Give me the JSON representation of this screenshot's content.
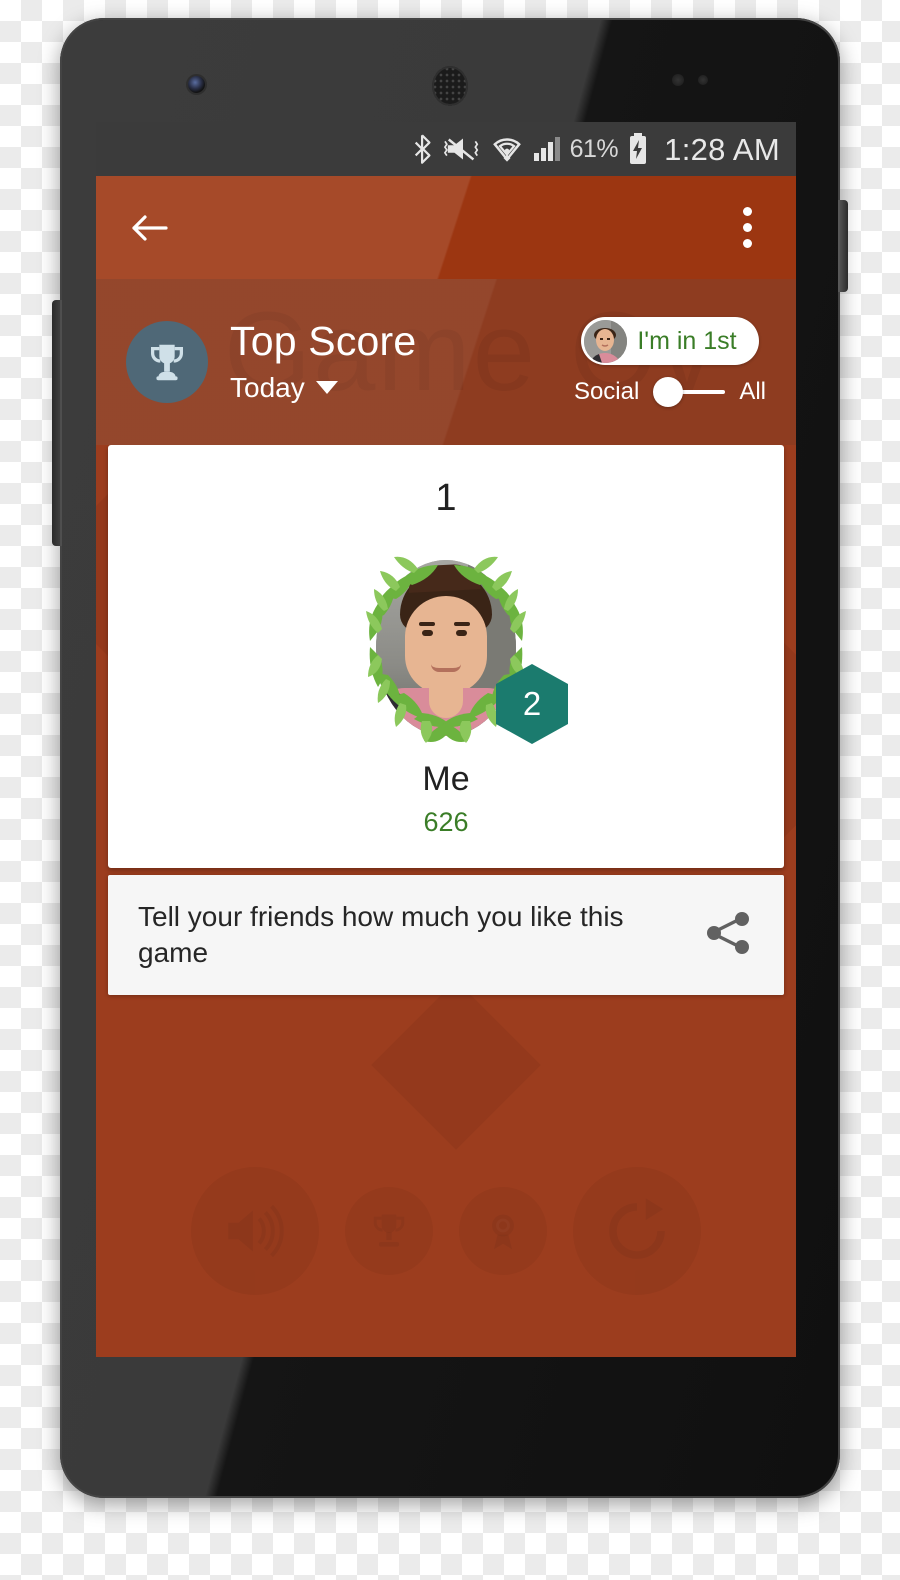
{
  "statusbar": {
    "icons": [
      "bluetooth-icon",
      "volume-mute-vibrate-icon",
      "wifi-icon",
      "cellular-signal-icon",
      "battery-charging-icon"
    ],
    "battery_percent": "61%",
    "time": "1:28 AM"
  },
  "toolbar": {
    "back_label": "back-arrow",
    "overflow_label": "more-options"
  },
  "header": {
    "watermark": "Game Ov",
    "title": "Top Score",
    "period": "Today",
    "rank_pill": "I'm in 1st",
    "toggle": {
      "left_label": "Social",
      "right_label": "All",
      "selected": "Social"
    }
  },
  "leaderboard": {
    "rank": "1",
    "name": "Me",
    "score": "626",
    "badge_level": "2"
  },
  "share": {
    "text": "Tell your friends how much you like this game",
    "icon": "share-icon"
  },
  "background_buttons": [
    {
      "name": "sound-button",
      "icon": "volume-up-icon"
    },
    {
      "name": "leaderboard-button",
      "icon": "trophy-icon"
    },
    {
      "name": "achievements-button",
      "icon": "medal-icon"
    },
    {
      "name": "replay-button",
      "icon": "refresh-icon"
    }
  ],
  "colors": {
    "app_bar": "#9c3611",
    "header": "#8e3c20",
    "background": "#9c3d1e",
    "accent_green": "#3a7d27",
    "badge_teal": "#1b7b6e",
    "trophy_circle": "#4f6877",
    "status_bar": "#3b3b3b"
  }
}
